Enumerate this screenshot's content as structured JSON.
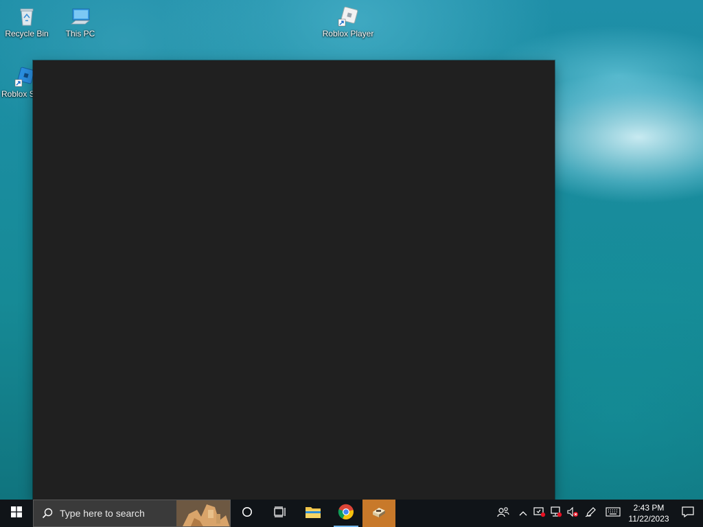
{
  "desktop": {
    "icons": [
      {
        "label": "Recycle Bin",
        "icon": "recycle-bin-icon"
      },
      {
        "label": "This PC",
        "icon": "computer-icon"
      },
      {
        "label": "Roblox Player",
        "icon": "roblox-icon"
      },
      {
        "label": "Roblox S",
        "icon": "roblox-studio-icon"
      }
    ]
  },
  "window": {
    "title": "",
    "background": "#202020"
  },
  "taskbar": {
    "search_placeholder": "Type here to search",
    "pinned": [
      {
        "name": "file-explorer",
        "icon": "folder-icon"
      },
      {
        "name": "chrome",
        "icon": "chrome-icon",
        "active": true
      },
      {
        "name": "app-running",
        "icon": "app-icon",
        "running": true
      }
    ],
    "clock": {
      "time": "2:43 PM",
      "date": "11/22/2023"
    }
  },
  "colors": {
    "taskbar": "#101418",
    "search": "#3a3a3a",
    "active_underline": "#76b9ed",
    "running_app": "#c8792a"
  }
}
